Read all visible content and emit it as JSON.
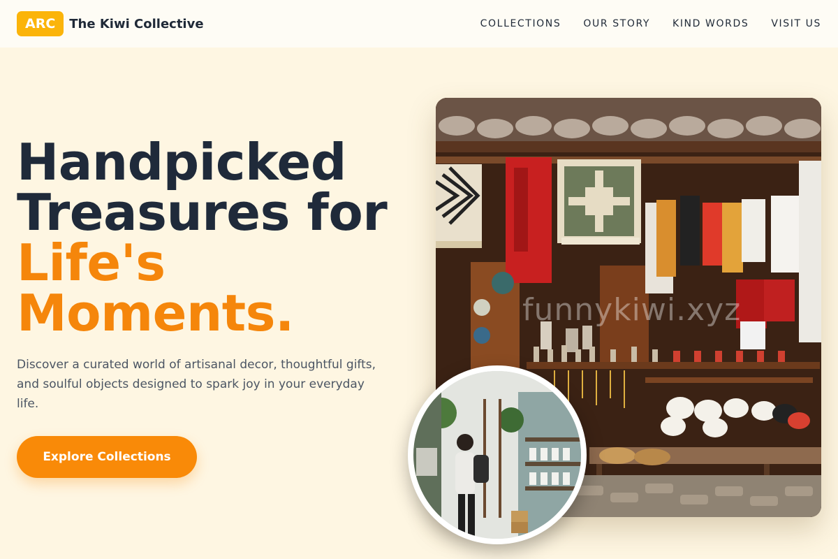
{
  "header": {
    "logo_text": "ARC",
    "brand_name": "The Kiwi Collective",
    "nav": [
      {
        "label": "COLLECTIONS"
      },
      {
        "label": "OUR STORY"
      },
      {
        "label": "KIND WORDS"
      },
      {
        "label": "VISIT US"
      }
    ]
  },
  "hero": {
    "title_line1": "Handpicked",
    "title_line2": "Treasures for",
    "title_accent_line1": "Life's",
    "title_accent_line2": "Moments.",
    "description": "Discover a curated world of artisanal decor, thoughtful gifts, and soulful objects designed to spark joy in your everyday life.",
    "cta_label": "Explore Collections"
  },
  "images": {
    "main_watermark": "funnykiwi.xyz"
  },
  "colors": {
    "background": "#fef6e2",
    "accent": "#f98a08",
    "logo": "#fbb40a",
    "heading": "#1f2a3a"
  }
}
